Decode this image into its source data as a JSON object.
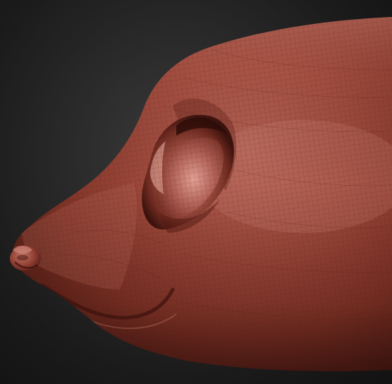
{
  "scene": {
    "subject": "sculpted-animal-head",
    "colors": {
      "background_center": "#3a3a3a",
      "background_edge": "#121212",
      "clay_base": "#8e3b2e",
      "clay_highlight": "#c97a6c",
      "clay_shadow": "#4a1a14",
      "wireframe": "#5a1f17"
    },
    "mesh_visible": true
  }
}
